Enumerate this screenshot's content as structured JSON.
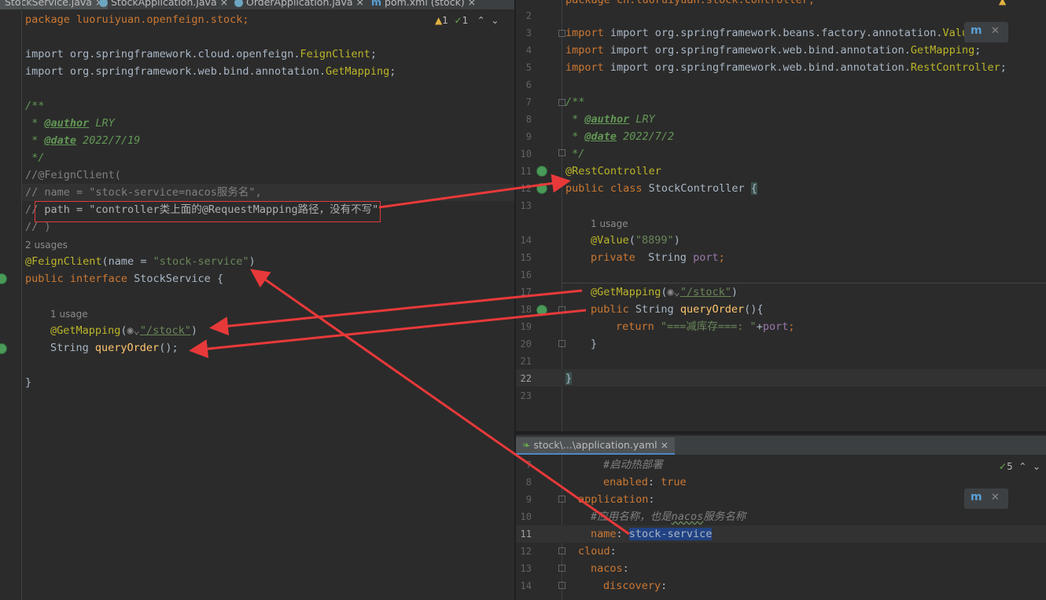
{
  "tabs": [
    {
      "label": "StockService.java",
      "active": true
    },
    {
      "label": "StockApplication.java",
      "active": false
    },
    {
      "label": "OrderApplication.java",
      "active": false
    },
    {
      "label": "pom.xml (stock)",
      "active": false
    }
  ],
  "left_editor": {
    "warnings": "1",
    "checks": "1",
    "usages_interface": "2 usages",
    "usages_method": "1 usage",
    "lines": {
      "package": "package luoruiyuan.openfeign.stock;",
      "import1_prefix": "import org.springframework.cloud.openfeign.",
      "import1_class": "FeignClient",
      "import2_prefix": "import org.springframework.web.bind.annotation.",
      "import2_class": "GetMapping",
      "doc_open": "/**",
      "doc_author_prefix": " * ",
      "doc_author_tag": "@author",
      "doc_author_val": " LRY",
      "doc_date_prefix": " * ",
      "doc_date_tag": "@date",
      "doc_date_val": " 2022/7/19",
      "doc_close": " */",
      "c1": "//@FeignClient(",
      "c2": "// name = \"stock-service=nacos服务名\",",
      "c3_prefix": "// ",
      "c3_body": "path = \"controller类上面的@RequestMapping路径，没有不写\"",
      "c4": "// )",
      "ann_name": "@FeignClient",
      "ann_args_a": "(name = ",
      "ann_args_str": "\"stock-service\"",
      "ann_args_b": ")",
      "iface_kw": "public interface ",
      "iface_name": "StockService {",
      "getmap_ann": "@GetMapping",
      "getmap_open": "(",
      "getmap_path": "\"/stock\"",
      "getmap_close": ")",
      "method_type": "String ",
      "method_name": "queryOrder",
      "method_tail": "();",
      "close": "}"
    }
  },
  "right_editor": {
    "lines": {
      "l1": "package cn.luoruiyuan.stock.controller;",
      "l3_prefix": "import org.springframework.beans.factory.annotation.",
      "l3_class": "Value",
      "l4_prefix": "import org.springframework.web.bind.annotation.",
      "l4_class": "GetMapping",
      "l5_prefix": "import org.springframework.web.bind.annotation.",
      "l5_class": "RestController",
      "l7": "/**",
      "l8_prefix": " * ",
      "l8_tag": "@author",
      "l8_val": " LRY",
      "l9_prefix": " * ",
      "l9_tag": "@date",
      "l9_val": " 2022/7/2",
      "l10": " */",
      "l11": "@RestController",
      "l12_kw": "public class ",
      "l12_name": "StockController ",
      "l12_brace": "{",
      "usage": "1 usage",
      "l14_ann": "@Value",
      "l14_open": "(",
      "l14_str": "\"8899\"",
      "l14_close": ")",
      "l15_kw": "private  ",
      "l15_type": "String ",
      "l15_field": "port",
      "l15_end": ";",
      "l17_ann": "@GetMapping",
      "l17_open": "(",
      "l17_str": "\"/stock\"",
      "l17_close": ")",
      "l18_kw": "public ",
      "l18_type": "String ",
      "l18_name": "queryOrder",
      "l18_tail": "(){",
      "l19_kw": "return ",
      "l19_str": "\"===减库存===: \"",
      "l19_plus": "+",
      "l19_field": "port",
      "l19_end": ";",
      "l20": "}",
      "l22": "}"
    }
  },
  "yaml_editor": {
    "tab_label": "stock\\...\\application.yaml",
    "checks": "5",
    "lines": {
      "l7": "#启动热部署",
      "l8_key": "enabled",
      "l8_val": "true",
      "l9": "application",
      "l10_a": "#应用名称，也是",
      "l10_b": "nacos",
      "l10_c": "服务名称",
      "l11_key": "name",
      "l11_val": "stock-service",
      "l12": "cloud",
      "l13": "nacos",
      "l14": "discovery"
    }
  },
  "colors": {
    "arrow": "#e8393a",
    "background": "#2b2b2b"
  }
}
